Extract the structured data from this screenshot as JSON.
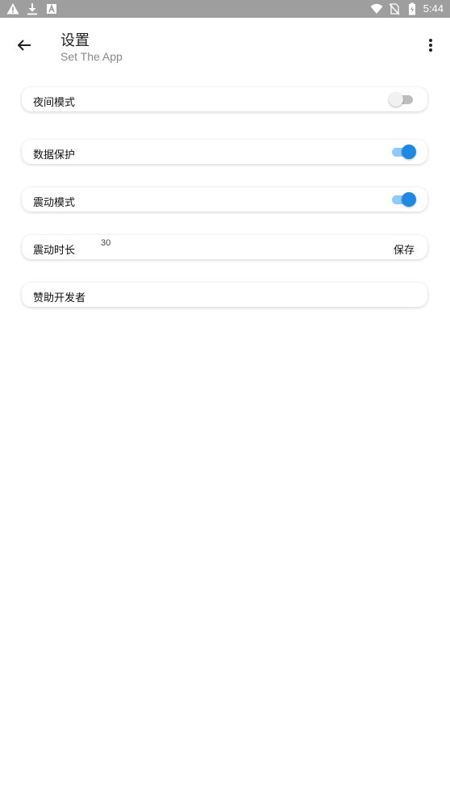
{
  "status_bar": {
    "time": "5:44",
    "left_icons": [
      "warning-icon",
      "download-icon",
      "a-box-icon"
    ],
    "right_icons": [
      "wifi-icon",
      "no-sim-icon",
      "battery-icon"
    ]
  },
  "app_bar": {
    "title": "设置",
    "subtitle": "Set The App"
  },
  "settings": {
    "night_mode": {
      "label": "夜间模式",
      "enabled": false
    },
    "data_protection": {
      "label": "数据保护",
      "enabled": true
    },
    "vibration_mode": {
      "label": "震动模式",
      "enabled": true
    },
    "vibration_duration": {
      "label": "震动时长",
      "value": "30",
      "save_label": "保存"
    },
    "sponsor": {
      "label": "赞助开发者"
    }
  },
  "colors": {
    "status_bar": "#9e9e9e",
    "switch_on": "#1e88e5",
    "switch_on_track": "#90caf9",
    "switch_off_thumb": "#f1f1f1",
    "switch_off_track": "#bdbdbd"
  }
}
